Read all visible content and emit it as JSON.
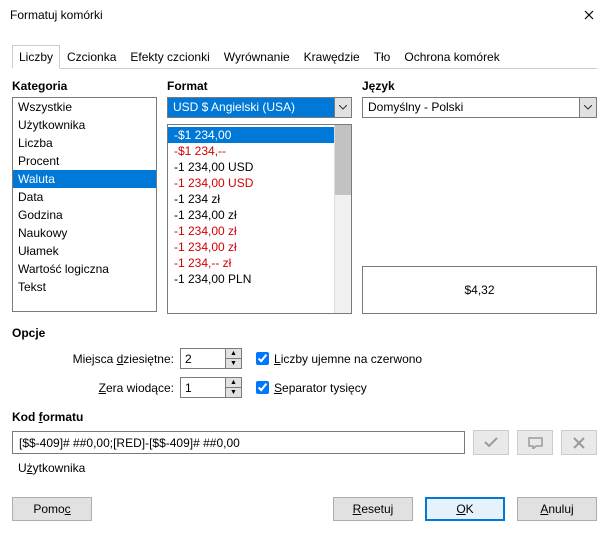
{
  "window": {
    "title": "Formatuj komórki"
  },
  "tabs": [
    "Liczby",
    "Czcionka",
    "Efekty czcionki",
    "Wyrównanie",
    "Krawędzie",
    "Tło",
    "Ochrona komórek"
  ],
  "active_tab": 0,
  "labels": {
    "category": "Kategoria",
    "format": "Format",
    "language": "Język",
    "options": "Opcje",
    "decimals": "Miejsca dziesiętne:",
    "leading": "Zera wiodące:",
    "neg_red": "Liczby ujemne na czerwono",
    "thousands": "Separator tysięcy",
    "format_code": "Kod formatu",
    "user": "Użytkownika"
  },
  "categories": [
    "Wszystkie",
    "Użytkownika",
    "Liczba",
    "Procent",
    "Waluta",
    "Data",
    "Godzina",
    "Naukowy",
    "Ułamek",
    "Wartość logiczna",
    "Tekst"
  ],
  "category_selected": 4,
  "format_combo": "USD $  Angielski (USA)",
  "formats": [
    {
      "text": "-$1 234,00",
      "red": false,
      "selected": true
    },
    {
      "text": "-$1 234,--",
      "red": true
    },
    {
      "text": "-1 234,00 USD",
      "red": false
    },
    {
      "text": "-1 234,00 USD",
      "red": true
    },
    {
      "text": "-1 234 zł",
      "red": false
    },
    {
      "text": "-1 234,00 zł",
      "red": false
    },
    {
      "text": "-1 234,00 zł",
      "red": true
    },
    {
      "text": "-1 234,00 zł",
      "red": true
    },
    {
      "text": "-1 234,-- zł",
      "red": true
    },
    {
      "text": "-1 234,00 PLN",
      "red": false
    }
  ],
  "language": "Domyślny - Polski",
  "preview": "$4,32",
  "decimals": "2",
  "leading": "1",
  "neg_red_checked": true,
  "thousands_checked": true,
  "format_code": "[$$-409]# ##0,00;[RED]-[$$-409]# ##0,00",
  "buttons": {
    "help": "Pomoc",
    "reset": "Resetuj",
    "ok": "OK",
    "cancel": "Anuluj"
  }
}
